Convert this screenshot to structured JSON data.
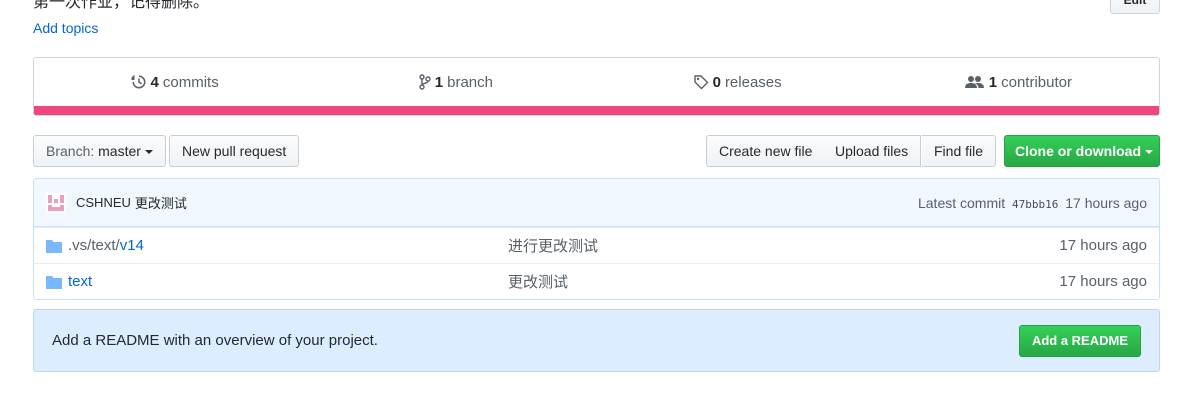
{
  "repo": {
    "description": "第一次作业，记得删除。",
    "edit_label": "Edit",
    "add_topics": "Add topics"
  },
  "numbers": {
    "commits_count": "4",
    "commits_label": "commits",
    "branches_count": "1",
    "branches_label": "branch",
    "releases_count": "0",
    "releases_label": "releases",
    "contributors_count": "1",
    "contributors_label": "contributor",
    "language_color": "#f1457d"
  },
  "toolbar": {
    "branch_prefix": "Branch:",
    "branch_name": "master",
    "new_pull_request": "New pull request",
    "create_new_file": "Create new file",
    "upload_files": "Upload files",
    "find_file": "Find file",
    "clone_or_download": "Clone or download"
  },
  "commit": {
    "author": "CSHNEU",
    "message": "更改测试",
    "latest_label": "Latest commit",
    "sha": "47bbb16",
    "age": "17 hours ago"
  },
  "files": [
    {
      "name_prefix": ".vs/text/",
      "name_link": "v14",
      "message": "进行更改测试",
      "age": "17 hours ago"
    },
    {
      "name_prefix": "",
      "name_link": "text",
      "message": "更改测试",
      "age": "17 hours ago"
    }
  ],
  "readme": {
    "prompt": "Add a README with an overview of your project.",
    "button": "Add a README"
  },
  "colors": {
    "link": "#0366d6",
    "primary_green": "#28a745",
    "readme_bg": "#dbedff"
  }
}
